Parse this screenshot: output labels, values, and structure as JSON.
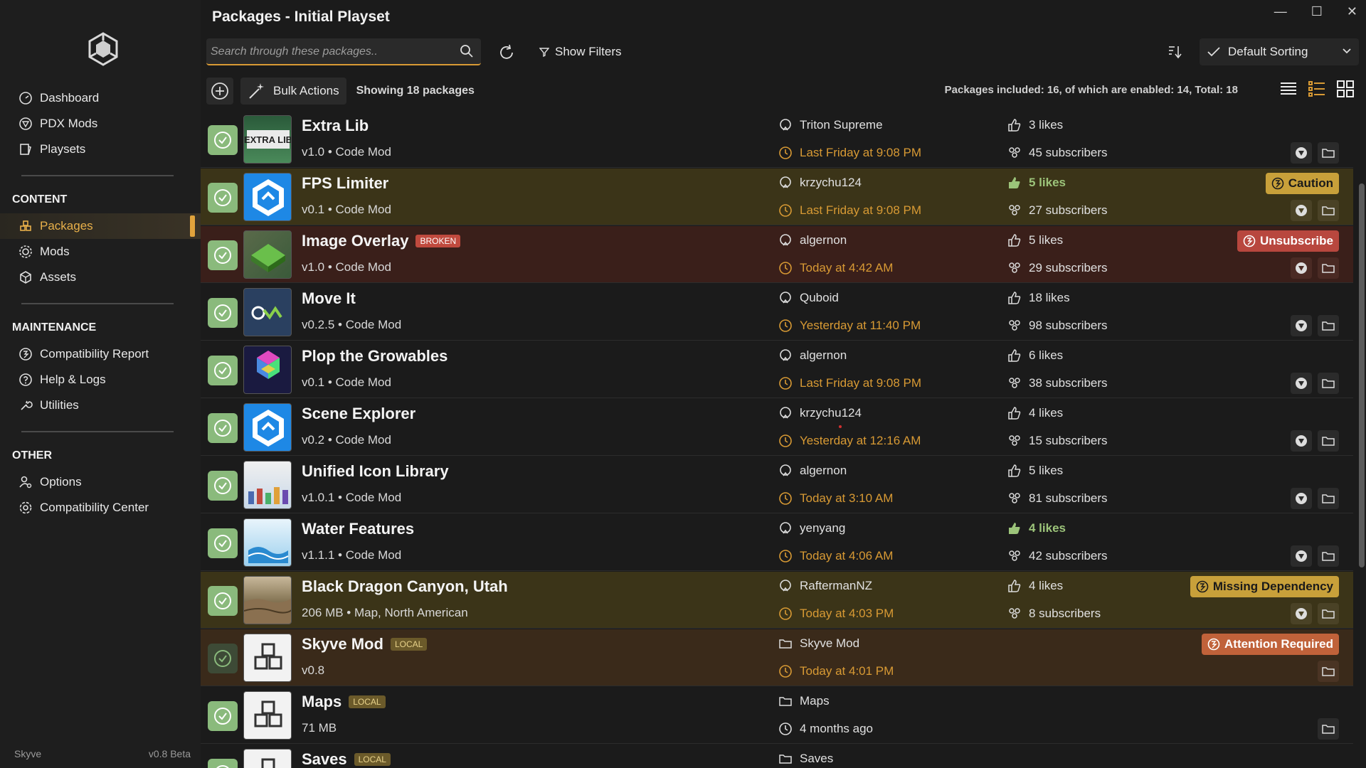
{
  "window": {
    "title": "Packages - Initial Playset",
    "minimize": "—",
    "maximize": "☐",
    "close": "✕"
  },
  "sidebar": {
    "top_items": [
      {
        "label": "Dashboard",
        "icon": "dashboard-icon"
      },
      {
        "label": "PDX Mods",
        "icon": "pdx-icon"
      },
      {
        "label": "Playsets",
        "icon": "playsets-icon"
      }
    ],
    "content_header": "CONTENT",
    "content_items": [
      {
        "label": "Packages",
        "icon": "packages-icon",
        "active": true
      },
      {
        "label": "Mods",
        "icon": "mods-icon"
      },
      {
        "label": "Assets",
        "icon": "assets-icon"
      }
    ],
    "maintenance_header": "MAINTENANCE",
    "maintenance_items": [
      {
        "label": "Compatibility Report",
        "icon": "compat-report-icon"
      },
      {
        "label": "Help & Logs",
        "icon": "help-icon"
      },
      {
        "label": "Utilities",
        "icon": "wrench-icon"
      }
    ],
    "other_header": "OTHER",
    "other_items": [
      {
        "label": "Options",
        "icon": "options-icon"
      },
      {
        "label": "Compatibility Center",
        "icon": "gear-icon"
      }
    ],
    "footer_app": "Skyve",
    "footer_version": "v0.8 Beta"
  },
  "topbar": {
    "search_placeholder": "Search through these packages..",
    "filters_label": "Show Filters",
    "sort_label": "Default Sorting"
  },
  "toolbar": {
    "bulk_label": "Bulk Actions",
    "count_label": "Showing 18 packages",
    "summary": "Packages included: 16, of which are enabled: 14, Total: 18"
  },
  "colors": {
    "accent": "#d89a34",
    "check": "#8aba7c",
    "caution": "#c8a03a",
    "broken": "#b8473e",
    "attention": "#c0623a"
  },
  "packages": [
    {
      "name": "Extra Lib",
      "meta": "v1.0 • Code Mod",
      "author": "Triton Supreme",
      "date": "Last Friday at 9:08 PM",
      "likes": "3 likes",
      "subs": "45 subscribers"
    },
    {
      "name": "FPS Limiter",
      "meta": "v0.1 • Code Mod",
      "author": "krzychu124",
      "date": "Last Friday at 9:08 PM",
      "likes": "5 likes",
      "subs": "27 subscribers",
      "badge": "Caution"
    },
    {
      "name": "Image Overlay",
      "tag": "BROKEN",
      "meta": "v1.0 • Code Mod",
      "author": "algernon",
      "date": "Today at 4:42 AM",
      "likes": "5 likes",
      "subs": "29 subscribers",
      "badge": "Unsubscribe"
    },
    {
      "name": "Move It",
      "meta": "v0.2.5 • Code Mod",
      "author": "Quboid",
      "date": "Yesterday at 11:40 PM",
      "likes": "18 likes",
      "subs": "98 subscribers"
    },
    {
      "name": "Plop the Growables",
      "meta": "v0.1 • Code Mod",
      "author": "algernon",
      "date": "Last Friday at 9:08 PM",
      "likes": "6 likes",
      "subs": "38 subscribers"
    },
    {
      "name": "Scene Explorer",
      "meta": "v0.2 • Code Mod",
      "author": "krzychu124",
      "date": "Yesterday at 12:16 AM",
      "likes": "4 likes",
      "subs": "15 subscribers"
    },
    {
      "name": "Unified Icon Library",
      "meta": "v1.0.1 • Code Mod",
      "author": "algernon",
      "date": "Today at 3:10 AM",
      "likes": "5 likes",
      "subs": "81 subscribers"
    },
    {
      "name": "Water Features",
      "meta": "v1.1.1 • Code Mod",
      "author": "yenyang",
      "date": "Today at 4:06 AM",
      "likes": "4 likes",
      "subs": "42 subscribers"
    },
    {
      "name": "Black Dragon Canyon, Utah",
      "meta": "206 MB • Map, North American",
      "author": "RaftermanNZ",
      "date": "Today at 4:03 PM",
      "likes": "4 likes",
      "subs": "8 subscribers",
      "badge": "Missing Dependency"
    },
    {
      "name": "Skyve Mod",
      "tag": "LOCAL",
      "meta": "v0.8",
      "author": "Skyve Mod",
      "date": "Today at 4:01 PM",
      "badge": "Attention Required"
    },
    {
      "name": "Maps",
      "tag": "LOCAL",
      "meta": "71 MB",
      "author": "Maps",
      "date": "4 months ago"
    },
    {
      "name": "Saves",
      "tag": "LOCAL",
      "author": "Saves"
    }
  ]
}
